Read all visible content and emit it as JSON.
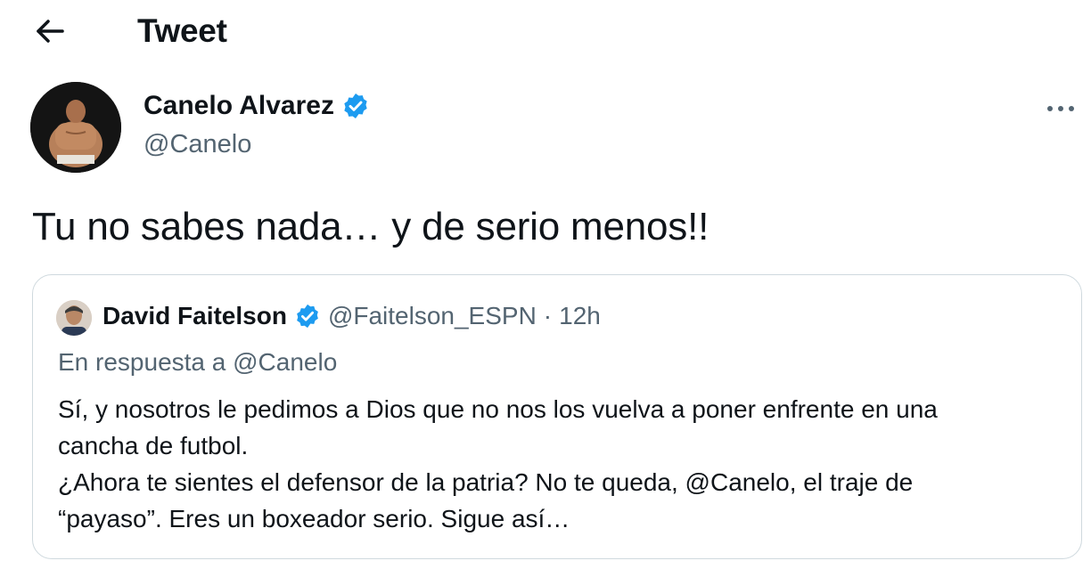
{
  "header": {
    "back_icon": "arrow-left-icon",
    "title": "Tweet"
  },
  "tweet": {
    "author": {
      "name": "Canelo Alvarez",
      "handle": "@Canelo",
      "verified": true
    },
    "more_icon": "more-horizontal-icon",
    "text": "Tu no sabes nada… y de serio menos!!"
  },
  "quoted_tweet": {
    "author": {
      "name": "David Faitelson",
      "handle": "@Faitelson_ESPN",
      "verified": true
    },
    "separator": "·",
    "time": "12h",
    "reply_context": "En respuesta a @Canelo",
    "lines": [
      "Sí, y nosotros le pedimos a Dios que no nos los vuelva a poner enfrente en una",
      "cancha de futbol.",
      "¿Ahora te sientes el defensor de la patria? No te queda, @Canelo, el traje de",
      "“payaso”. Eres un boxeador serio. Sigue así…"
    ]
  },
  "colors": {
    "text_primary": "#0f1419",
    "text_secondary": "#536471",
    "verified_blue": "#1d9bf0",
    "border": "#cfd9de"
  }
}
